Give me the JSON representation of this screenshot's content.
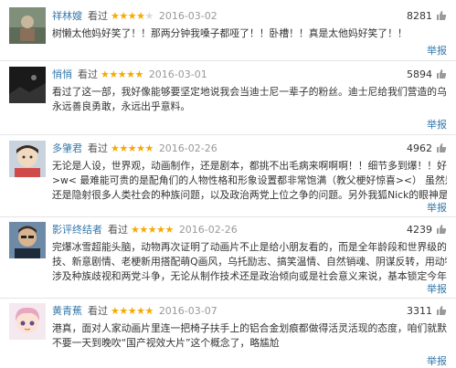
{
  "reviews": [
    {
      "username": "祥林嫂",
      "watched": "看过",
      "rating": 4,
      "date": "2016-03-02",
      "votes": "8281",
      "lines": [
        "树懒太他妈好笑了！！那两分钟我嗓子都哑了！！卧槽！！真是太他妈好笑了！！"
      ],
      "report": "举报"
    },
    {
      "username": "悄悄",
      "watched": "看过",
      "rating": 5,
      "date": "2016-03-01",
      "votes": "5894",
      "lines": [
        "看过了这一部，我好像能够要坚定地说我会当迪士尼一辈子的粉丝。迪士尼给我们营造的乌托邦就是这样，",
        "永远善良勇敢，永远出乎意料。"
      ],
      "report": "举报"
    },
    {
      "username": "多肇君",
      "watched": "看过",
      "rating": 5,
      "date": "2016-02-26",
      "votes": "4962",
      "lines": [
        "无论是人设，世界观，动画制作，还是剧本，都挑不出毛病来啊啊啊！！细节多到爆！！好幸福！！！",
        ">w< 最难能可贵的是配角们的人物性格和形象设置都非常饱满（教父梗好惊喜><） 虽然是动画，但是剧本",
        "还是隐射很多人类社会的种族问题，以及政治两党上位之争的问题。另外我狐Nick的眼神是在太苏了TwT..."
      ],
      "report": "举报"
    },
    {
      "username": "影评终结者",
      "watched": "看过",
      "rating": 5,
      "date": "2016-02-26",
      "votes": "4239",
      "lines": [
        "完爆冰雪超能头脑，动物再次证明了动画片不止是给小朋友看的，而是全年龄段和世界级的，尖端数码特",
        "技、新意剧情、老梗新用搭配萌Q画风，乌托励志、搞笑温情、自然销魂、阴谋反转，用动物来映射人类，",
        "涉及种族歧视和两党斗争，无论从制作技术还是政治倾向或是社会意义来说，基本锁定今年奥斯卡最佳动画"
      ],
      "report": "举报"
    },
    {
      "username": "黄青蕉",
      "watched": "看过",
      "rating": 5,
      "date": "2016-03-07",
      "votes": "3311",
      "lines": [
        "港真，面对人家动画片里连一把椅子扶手上的铝合金划痕都做得活灵活现的态度，咱们就默默低头学就好，",
        "不要一天到晚吹“国产视效大片”这个概念了，略尴尬"
      ],
      "report": "举报"
    }
  ],
  "colors": {
    "link": "#3377aa",
    "star": "#f7a900",
    "muted": "#999999"
  }
}
